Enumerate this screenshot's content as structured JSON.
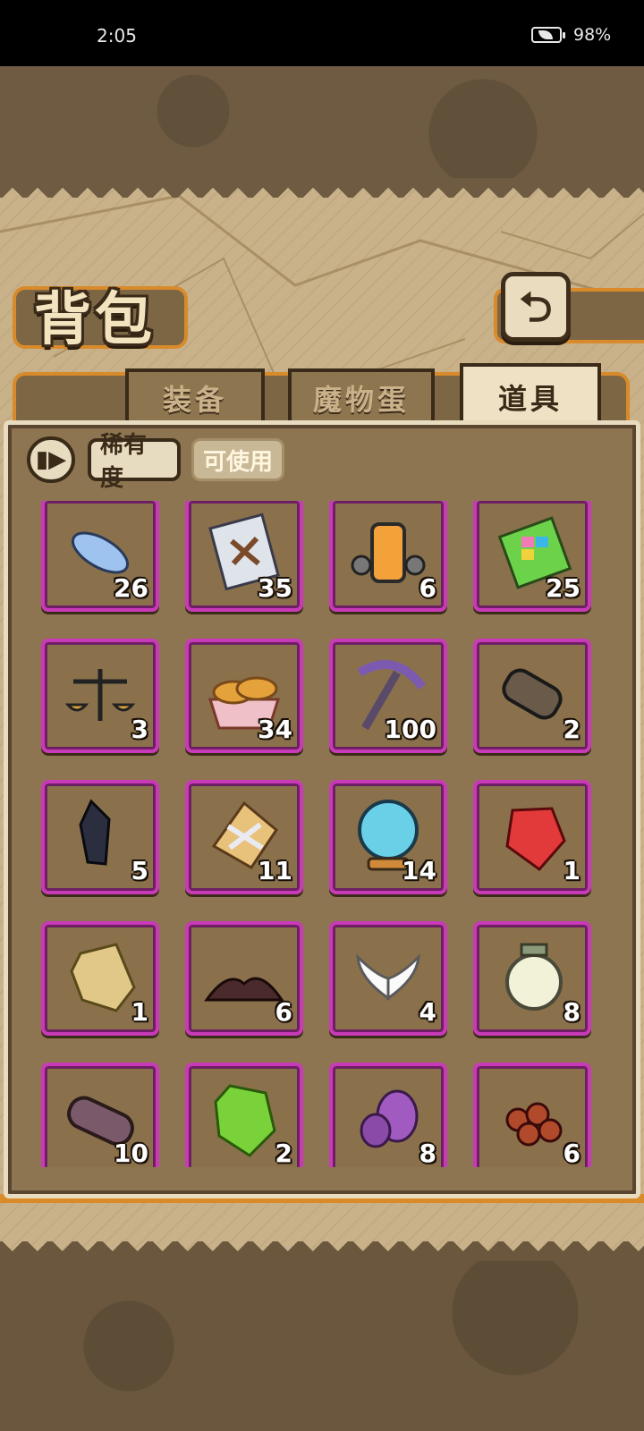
{
  "status_bar": {
    "time": "2:05",
    "battery": "98%"
  },
  "header": {
    "title": "背包",
    "back_icon": "back-arrow-icon"
  },
  "tabs": [
    {
      "label": "装备",
      "active": false
    },
    {
      "label": "魔物蛋",
      "active": false
    },
    {
      "label": "道具",
      "active": true
    }
  ],
  "filters": {
    "sort_icon": "sort-toggle-icon",
    "rarity_label": "稀有度",
    "usable_label": "可使用"
  },
  "colors": {
    "slot_border": "#c93ab8",
    "panel_brown": "#8e7551",
    "accent_orange": "#d98a2a"
  },
  "items": [
    {
      "icon": "blue-feather-icon",
      "quantity": "26"
    },
    {
      "icon": "scroll-page-icon",
      "quantity": "35"
    },
    {
      "icon": "lantern-canister-icon",
      "quantity": "6"
    },
    {
      "icon": "rainbow-book-icon",
      "quantity": "25"
    },
    {
      "icon": "scales-icon",
      "quantity": "3"
    },
    {
      "icon": "bread-basket-icon",
      "quantity": "34"
    },
    {
      "icon": "pickaxe-icon",
      "quantity": "100"
    },
    {
      "icon": "barrel-cylinder-icon",
      "quantity": "2"
    },
    {
      "icon": "dark-crystal-icon",
      "quantity": "5"
    },
    {
      "icon": "gold-seal-icon",
      "quantity": "11"
    },
    {
      "icon": "crystal-ball-icon",
      "quantity": "14"
    },
    {
      "icon": "red-gem-icon",
      "quantity": "1"
    },
    {
      "icon": "gold-gem-icon",
      "quantity": "1"
    },
    {
      "icon": "dust-pile-icon",
      "quantity": "6"
    },
    {
      "icon": "white-wings-icon",
      "quantity": "4"
    },
    {
      "icon": "glass-lantern-icon",
      "quantity": "8"
    },
    {
      "icon": "shell-capsule-icon",
      "quantity": "10"
    },
    {
      "icon": "green-gem-icon",
      "quantity": "2"
    },
    {
      "icon": "purple-egg-icon",
      "quantity": "8"
    },
    {
      "icon": "red-berries-icon",
      "quantity": "6"
    }
  ]
}
